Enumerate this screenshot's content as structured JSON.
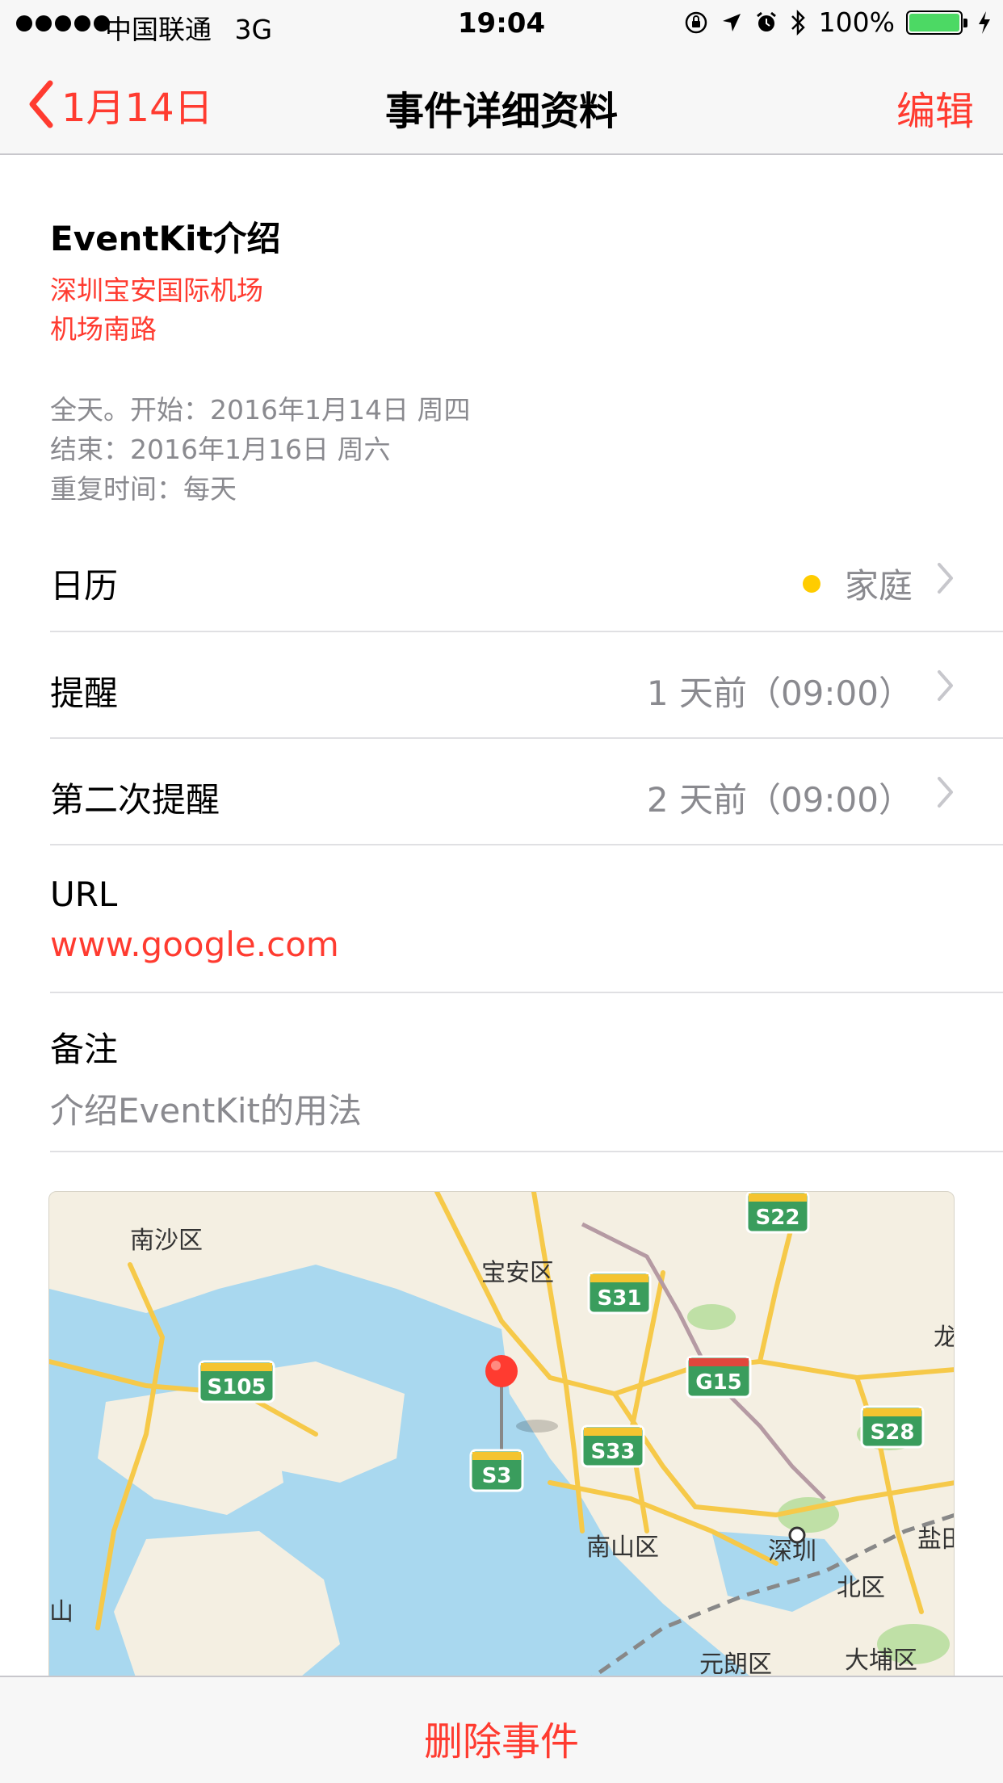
{
  "status_bar": {
    "carrier": "中国联通",
    "network": "3G",
    "time": "19:04",
    "battery": "100%"
  },
  "nav": {
    "back_label": "1月14日",
    "title": "事件详细资料",
    "edit_label": "编辑"
  },
  "event": {
    "title": "EventKit介绍",
    "location_line1": "深圳宝安国际机场",
    "location_line2": "机场南路",
    "date_line1": "全天。开始：2016年1月14日 周四",
    "date_line2": "结束：2016年1月16日 周六",
    "date_line3": "重复时间：每天"
  },
  "rows": {
    "calendar": {
      "label": "日历",
      "value": "家庭"
    },
    "alert": {
      "label": "提醒",
      "value": "1 天前（09:00）"
    },
    "second_alert": {
      "label": "第二次提醒",
      "value": "2 天前（09:00）"
    }
  },
  "url": {
    "label": "URL",
    "value": "www.google.com"
  },
  "notes": {
    "label": "备注",
    "value": "介绍EventKit的用法"
  },
  "map": {
    "labels": {
      "nansha": "南沙区",
      "baoan": "宝安区",
      "nanshan": "南山区",
      "shenzhen": "深圳",
      "beiqu": "北区",
      "yuanlang": "元朗区",
      "dapu": "大埔区",
      "long": "龙",
      "yan": "盐田",
      "shan": "山"
    },
    "shields": {
      "s22": "S22",
      "s31": "S31",
      "s105": "S105",
      "g15": "G15",
      "s28": "S28",
      "s33": "S33",
      "s3": "S3"
    }
  },
  "bottom": {
    "delete_label": "删除事件"
  },
  "colors": {
    "accent": "#ff3b30",
    "secondary": "#8a8a8f",
    "calendar_dot": "#ffcc00",
    "battery": "#4cd964"
  }
}
